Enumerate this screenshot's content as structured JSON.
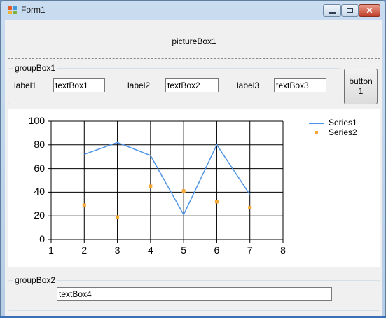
{
  "window": {
    "title": "Form1"
  },
  "picturebox": {
    "label": "pictureBox1"
  },
  "groupbox1": {
    "caption": "groupBox1",
    "label1": "label1",
    "textbox1": "textBox1",
    "label2": "label2",
    "textbox2": "textBox2",
    "label3": "label3",
    "textbox3": "textBox3"
  },
  "button1": {
    "line1": "button",
    "line2": "1"
  },
  "groupbox2": {
    "caption": "groupBox2",
    "textbox4": "textBox4"
  },
  "chart_data": {
    "type": "line",
    "xlim": [
      1,
      8
    ],
    "ylim": [
      0,
      100
    ],
    "x_ticks": [
      "1",
      "2",
      "3",
      "4",
      "5",
      "6",
      "7",
      "8"
    ],
    "y_ticks": [
      "0",
      "20",
      "40",
      "60",
      "80",
      "100"
    ],
    "grid": true,
    "legend_position": "top-right",
    "series": [
      {
        "name": "Series1",
        "type": "line",
        "color": "#4f94e6",
        "x": [
          2,
          3,
          4,
          5,
          6,
          7
        ],
        "y": [
          72,
          82,
          71,
          21,
          80,
          38
        ]
      },
      {
        "name": "Series2",
        "type": "scatter",
        "color": "#f7a733",
        "x": [
          2,
          3,
          4,
          5,
          6,
          7
        ],
        "y": [
          29,
          19,
          45,
          41,
          32,
          27
        ]
      }
    ]
  }
}
